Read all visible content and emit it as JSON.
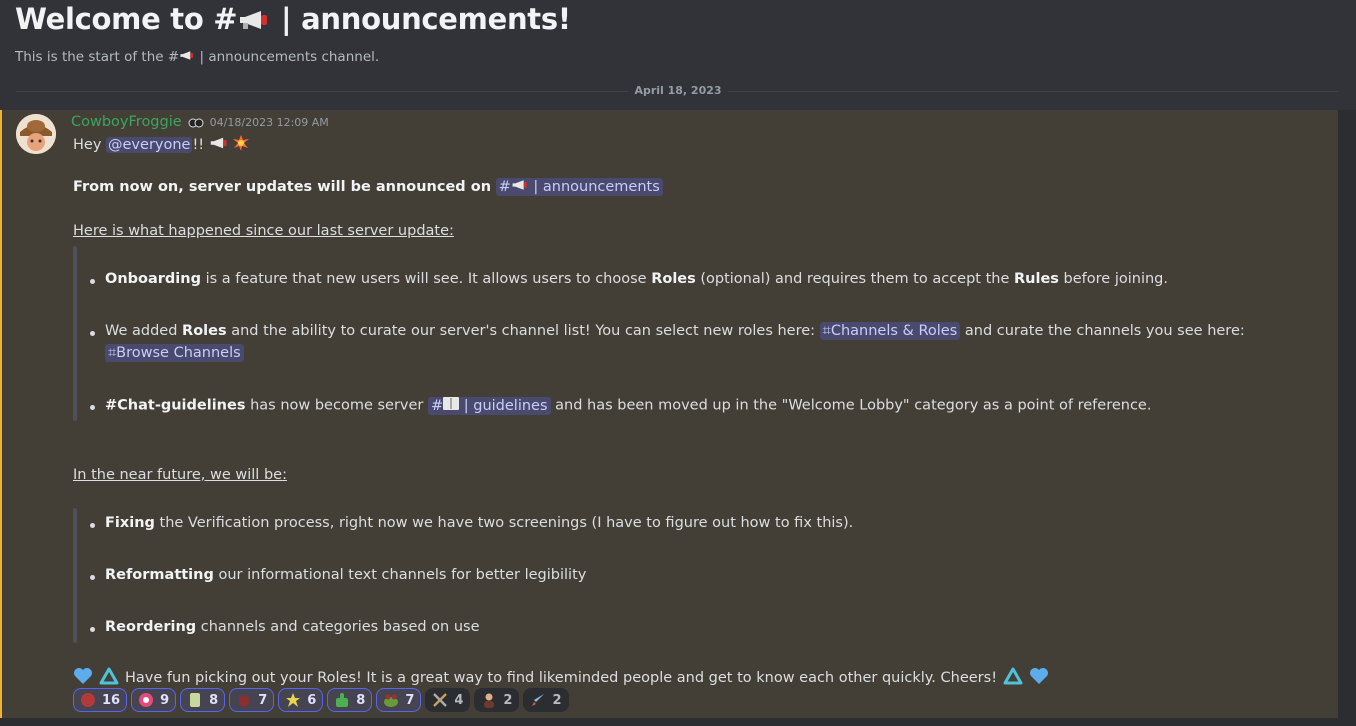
{
  "welcome": {
    "title_prefix": "Welcome to #",
    "title_suffix": " | announcements!",
    "sub_prefix": "This is the start of the #",
    "sub_suffix": " | announcements channel."
  },
  "divider_date": "April 18, 2023",
  "message": {
    "author": "CowboyFroggie",
    "timestamp": "04/18/2023 12:09 AM",
    "greeting_pre": "Hey ",
    "mention": "@everyone",
    "greeting_post": "!! ",
    "lead": "From now on, server updates will be announced on",
    "lead_channel": "| announcements",
    "heading1": "Here is what happened since our last server update:",
    "b1_bold1": "Onboarding",
    "b1_t1": " is a feature that new users will see. It allows users to choose ",
    "b1_bold2": "Roles",
    "b1_t2": " (optional) and requires them to accept the ",
    "b1_bold3": "Rules",
    "b1_t3": " before joining.",
    "b2_t1": "We added ",
    "b2_bold1": "Roles",
    "b2_t2": " and the ability to curate our server's channel list! You can select new roles here: ",
    "b2_chan1": "Channels & Roles",
    "b2_t3": " and curate the channels you see here:",
    "b2_chan2": "Browse Channels",
    "b3_bold1": "#Chat-guidelines",
    "b3_t1": " has now become server ",
    "b3_chan": "| guidelines",
    "b3_t2": " and has been moved up in the \"Welcome Lobby\" category as a point of reference.",
    "heading2": "In the near future, we will be:",
    "f1_bold": "Fixing",
    "f1_t": " the Verification process, right now we have two screenings (I have to figure out how to fix this).",
    "f2_bold": "Reformatting",
    "f2_t": " our informational text channels for better legibility",
    "f3_bold": "Reordering",
    "f3_t": " channels and categories based on use",
    "closing": "Have fun picking out your Roles! It is a great way to find likeminded people and get to know each other quickly. Cheers!"
  },
  "reactions": [
    {
      "icon": "red-emoji-icon",
      "count": "16",
      "active": true
    },
    {
      "icon": "pink-emoji-icon",
      "count": "9",
      "active": true
    },
    {
      "icon": "scroll-emoji-icon",
      "count": "8",
      "active": true
    },
    {
      "icon": "bug-emoji-icon",
      "count": "7",
      "active": true
    },
    {
      "icon": "pin-emoji-icon",
      "count": "6",
      "active": true
    },
    {
      "icon": "thumbs-up-emoji-icon",
      "count": "8",
      "active": true
    },
    {
      "icon": "frog-emoji-icon",
      "count": "7",
      "active": true
    },
    {
      "icon": "tools-emoji-icon",
      "count": "4",
      "active": false
    },
    {
      "icon": "person-emoji-icon",
      "count": "2",
      "active": false
    },
    {
      "icon": "rocket-emoji-icon",
      "count": "2",
      "active": false
    }
  ],
  "colors": {
    "username": "#3ba55d",
    "mention_bg": "#4a4f8f",
    "highlight_bg": "#433f36",
    "highlight_bar": "#f0b232"
  }
}
